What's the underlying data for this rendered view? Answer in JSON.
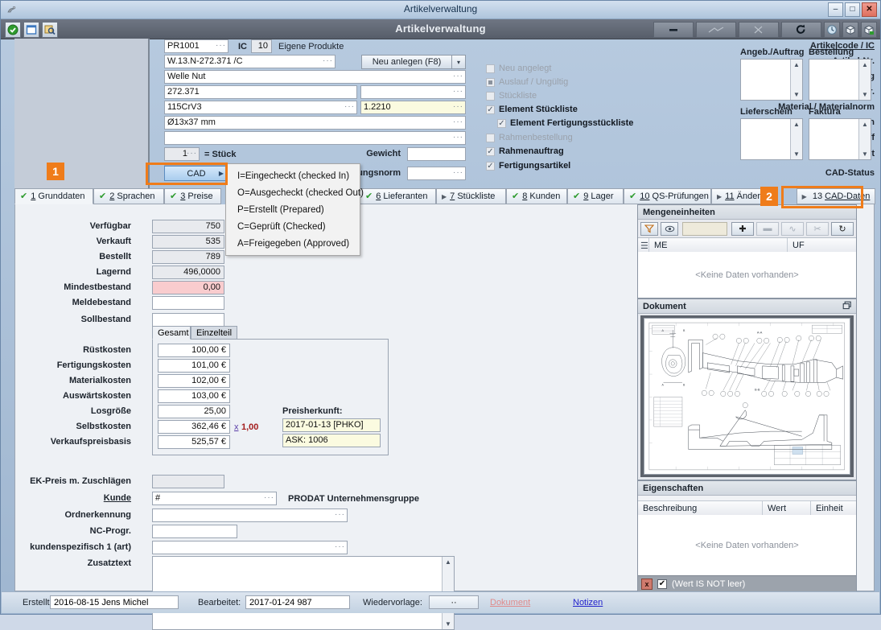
{
  "window": {
    "title": "Artikelverwaltung",
    "module_title": "Artikelverwaltung",
    "minimize": "–",
    "maximize": "□",
    "close": "✕"
  },
  "toolbar": {
    "left": [
      {
        "name": "ok-check-icon",
        "glyph": "✔"
      },
      {
        "name": "window-icon",
        "glyph": "▭"
      },
      {
        "name": "search-record-icon",
        "glyph": "🔍"
      }
    ],
    "right": [
      {
        "name": "minus-button",
        "glyph": "▬"
      },
      {
        "name": "curve-button",
        "glyph": "∿"
      },
      {
        "name": "cut-button",
        "glyph": "✂"
      },
      {
        "name": "refresh-button",
        "glyph": "↻"
      },
      {
        "name": "clock-button",
        "glyph": "◔"
      },
      {
        "name": "box-button",
        "glyph": "▣"
      },
      {
        "name": "box-export-button",
        "glyph": "▣"
      }
    ]
  },
  "header_form": {
    "labels": {
      "artikelcode": "Artikelcode / IC",
      "artikelnr": "Artikel-Nr.",
      "bezeichnung": "Bezeichnung",
      "zeichnungsnr": "Zeichnungs-Nr.",
      "material": "Material / Materialnorm",
      "dimension": "Dimension",
      "suchbegriff": "Suchbegriff",
      "mengeneinheit": "Mengeneinheit",
      "cadstatus": "CAD-Status",
      "ic": "IC",
      "gewicht": "Gewicht",
      "fertigungsnorm": "Fertigungsnorm",
      "stueck_eq": "= Stück"
    },
    "values": {
      "artikelcode": "PR1001",
      "ic_number": "10",
      "ic_text": "Eigene Produkte",
      "artikelnr": "W.13.N-272.371 /C",
      "bezeichnung": "Welle Nut",
      "zeichnungsnr": "272.371",
      "zeichnungsnr2": "",
      "material": "115CrV3",
      "materialnorm": "1.2210",
      "dimension": "Ø13x37 mm",
      "suchbegriff": "",
      "mengeneinheit": "1",
      "gewicht": "",
      "fertigungsnorm": "",
      "cadstatus": ""
    },
    "new_button": "Neu anlegen (F8)"
  },
  "status_flags": [
    {
      "label": "Neu angelegt",
      "checked": false,
      "enabled": false,
      "style": "empty"
    },
    {
      "label": "Auslauf / Ungültig",
      "checked": false,
      "enabled": false,
      "style": "square"
    },
    {
      "label": "Stückliste",
      "checked": false,
      "enabled": false,
      "style": "empty"
    },
    {
      "label": "Element Stückliste",
      "checked": true,
      "enabled": true,
      "style": "tick"
    },
    {
      "label": "Element Fertigungsstückliste",
      "checked": true,
      "enabled": true,
      "style": "tick",
      "indent": true
    },
    {
      "label": "Rahmenbestellung",
      "checked": false,
      "enabled": false,
      "style": "empty"
    },
    {
      "label": "Rahmenauftrag",
      "checked": true,
      "enabled": true,
      "style": "tick"
    },
    {
      "label": "Fertigungsartikel",
      "checked": true,
      "enabled": true,
      "style": "tick"
    }
  ],
  "doc_boxes": [
    {
      "caption": "Angeb./Auftrag"
    },
    {
      "caption": "Bestellung"
    },
    {
      "caption": "Lieferschein"
    },
    {
      "caption": "Faktura"
    }
  ],
  "tabs": [
    {
      "num": "1",
      "label": "Grunddaten",
      "icon": "check",
      "active": true
    },
    {
      "num": "2",
      "label": "Sprachen",
      "icon": "check",
      "active": false
    },
    {
      "num": "3",
      "label": "Preise",
      "icon": "check",
      "active": false
    },
    {
      "num": "6",
      "label": "Lieferanten",
      "icon": "check",
      "active": false
    },
    {
      "num": "7",
      "label": "Stückliste",
      "icon": "arrow",
      "active": false
    },
    {
      "num": "8",
      "label": "Kunden",
      "icon": "check",
      "active": false
    },
    {
      "num": "9",
      "label": "Lager",
      "icon": "check",
      "active": false
    },
    {
      "num": "10",
      "label": "QS-Prüfungen",
      "icon": "check",
      "active": false
    },
    {
      "num": "11",
      "label": "Änderu",
      "icon": "arrow",
      "active": false
    },
    {
      "num": "13",
      "label": "CAD-Daten",
      "icon": "arrow",
      "active": false,
      "highlighted": true
    }
  ],
  "cad_menu": {
    "button_label": "CAD",
    "items": [
      "I=Eingecheckt (checked In)",
      "O=Ausgecheckt (checked Out)",
      "P=Erstellt (Prepared)",
      "C=Geprüft (Checked)",
      "A=Freigegeben (Approved)"
    ]
  },
  "markers": [
    {
      "id": "1",
      "target": "cad-status-field"
    },
    {
      "id": "2",
      "target": "tab-13-cad-daten"
    }
  ],
  "stock": {
    "rows": [
      {
        "label": "Verfügbar",
        "value": "750",
        "style": "ro"
      },
      {
        "label": "Verkauft",
        "value": "535",
        "style": "ro"
      },
      {
        "label": "Bestellt",
        "value": "789",
        "style": "ro"
      },
      {
        "label": "Lagernd",
        "value": "496,0000",
        "style": "ro"
      },
      {
        "label": "Mindestbestand",
        "value": "0,00",
        "style": "pink"
      },
      {
        "label": "Meldebestand",
        "value": "",
        "style": "white"
      },
      {
        "label": "Sollbestand",
        "value": "",
        "style": "white"
      }
    ]
  },
  "price_panel": {
    "tabs": [
      {
        "label": "Gesamt",
        "active": true
      },
      {
        "label": "Einzelteil",
        "active": false
      }
    ],
    "rows": [
      {
        "label": "Rüstkosten",
        "value": "100,00 €"
      },
      {
        "label": "Fertigungskosten",
        "value": "101,00 €"
      },
      {
        "label": "Materialkosten",
        "value": "102,00 €"
      },
      {
        "label": "Auswärtskosten",
        "value": "103,00 €"
      },
      {
        "label": "Losgröße",
        "value": "25,00"
      },
      {
        "label": "Selbstkosten",
        "value": "362,46 €"
      },
      {
        "label": "Verkaufspreisbasis",
        "value": "525,57 €"
      }
    ],
    "multiplier_symbol": "x",
    "multiplier": "1,00",
    "origin_caption": "Preisherkunft:",
    "origin_date": "2017-01-13 [PHKO]",
    "origin_ask": "ASK: 1006"
  },
  "lower_form": {
    "rows": [
      {
        "label": "EK-Preis m. Zuschlägen",
        "value": "",
        "style": "ro",
        "link": false
      },
      {
        "label": "Kunde",
        "value": "#",
        "style": "white",
        "link": true,
        "suffix": "PRODAT Unternehmensgruppe"
      },
      {
        "label": "Ordnerkennung",
        "value": "",
        "style": "white",
        "link": false
      },
      {
        "label": "NC-Progr.",
        "value": "",
        "style": "white",
        "link": false
      },
      {
        "label": "kundenspezifisch 1 (art)",
        "value": "",
        "style": "white",
        "link": false
      },
      {
        "label": "Zusatztext",
        "value": "",
        "style": "textarea",
        "link": false
      }
    ]
  },
  "mengeneinheiten_panel": {
    "title": "Mengeneinheiten",
    "toolbar": [
      {
        "name": "filter-icon",
        "glyph": "▽",
        "enabled": true
      },
      {
        "name": "eye-icon",
        "glyph": "👁",
        "enabled": true
      },
      {
        "name": "add-button",
        "glyph": "✚",
        "enabled": true
      },
      {
        "name": "remove-button",
        "glyph": "▬",
        "enabled": false
      },
      {
        "name": "edit-button",
        "glyph": "∿",
        "enabled": false
      },
      {
        "name": "cut-button",
        "glyph": "✂",
        "enabled": false
      },
      {
        "name": "refresh-button",
        "glyph": "↻",
        "enabled": true
      }
    ],
    "columns": [
      "ME",
      "UF"
    ],
    "empty_text": "<Keine Daten vorhanden>"
  },
  "dokument_panel": {
    "title": "Dokument",
    "restore_icon": "▣"
  },
  "eigenschaften_panel": {
    "title": "Eigenschaften",
    "columns": [
      "Beschreibung",
      "Wert",
      "Einheit"
    ],
    "empty_text": "<Keine Daten vorhanden>",
    "filter_text": "(Wert IS NOT leer)",
    "filter_close": "x",
    "filter_checked": true
  },
  "statusbar": {
    "erstellt_label": "Erstellt:",
    "erstellt_value": "2016-08-15  Jens Michel",
    "bearbeitet_label": "Bearbeitet:",
    "bearbeitet_value": "2017-01-24  987",
    "wiedervorlage_label": "Wiedervorlage:",
    "wiedervorlage_value": "··",
    "dokument_link": "Dokument",
    "notizen_link": "Notizen"
  },
  "colors": {
    "accent": "#ef7c1a",
    "check_green": "#2e9b2e",
    "warn_pink": "#f9ccce",
    "yellow": "#fbfbe0",
    "link_blue": "#2222cc",
    "link_red": "#e08b8b"
  }
}
